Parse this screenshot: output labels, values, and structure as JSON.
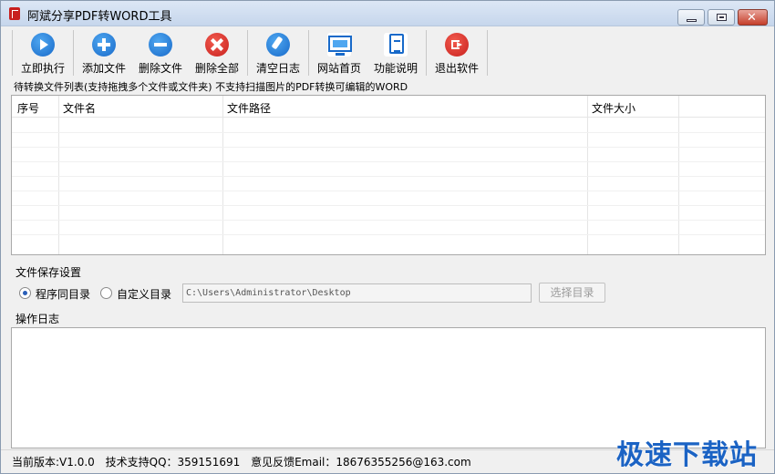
{
  "window": {
    "title": "阿斌分享PDF转WORD工具",
    "close_glyph": "✕"
  },
  "toolbar": {
    "execute": "立即执行",
    "add_file": "添加文件",
    "delete_file": "删除文件",
    "delete_all": "删除全部",
    "clear_log": "清空日志",
    "website": "网站首页",
    "help": "功能说明",
    "exit": "退出软件"
  },
  "file_list": {
    "hint": "待转换文件列表(支持拖拽多个文件或文件夹) 不支持扫描图片的PDF转换可编辑的WORD",
    "columns": [
      "序号",
      "文件名",
      "文件路径",
      "文件大小"
    ],
    "rows": []
  },
  "save_settings": {
    "title": "文件保存设置",
    "option_program_dir": "程序同目录",
    "option_custom_dir": "自定义目录",
    "selected": "程序同目录",
    "path_value": "C:\\Users\\Administrator\\Desktop",
    "choose_dir_button": "选择目录"
  },
  "log": {
    "title": "操作日志",
    "content": ""
  },
  "status": {
    "version": "当前版本:V1.0.0",
    "support": "技术支持QQ：359151691",
    "feedback": "意见反馈Email：18676355256@163.com"
  },
  "watermark": "极速下载站",
  "colors": {
    "accent_blue": "#1769c9",
    "accent_red": "#c8201e",
    "watermark_blue": "#1b63c4"
  },
  "icons": {
    "execute": "play-icon",
    "add_file": "plus-icon",
    "delete_file": "minus-icon",
    "delete_all": "x-circle-icon",
    "clear_log": "brush-icon",
    "website": "monitor-icon",
    "help": "document-icon",
    "exit": "exit-icon"
  }
}
